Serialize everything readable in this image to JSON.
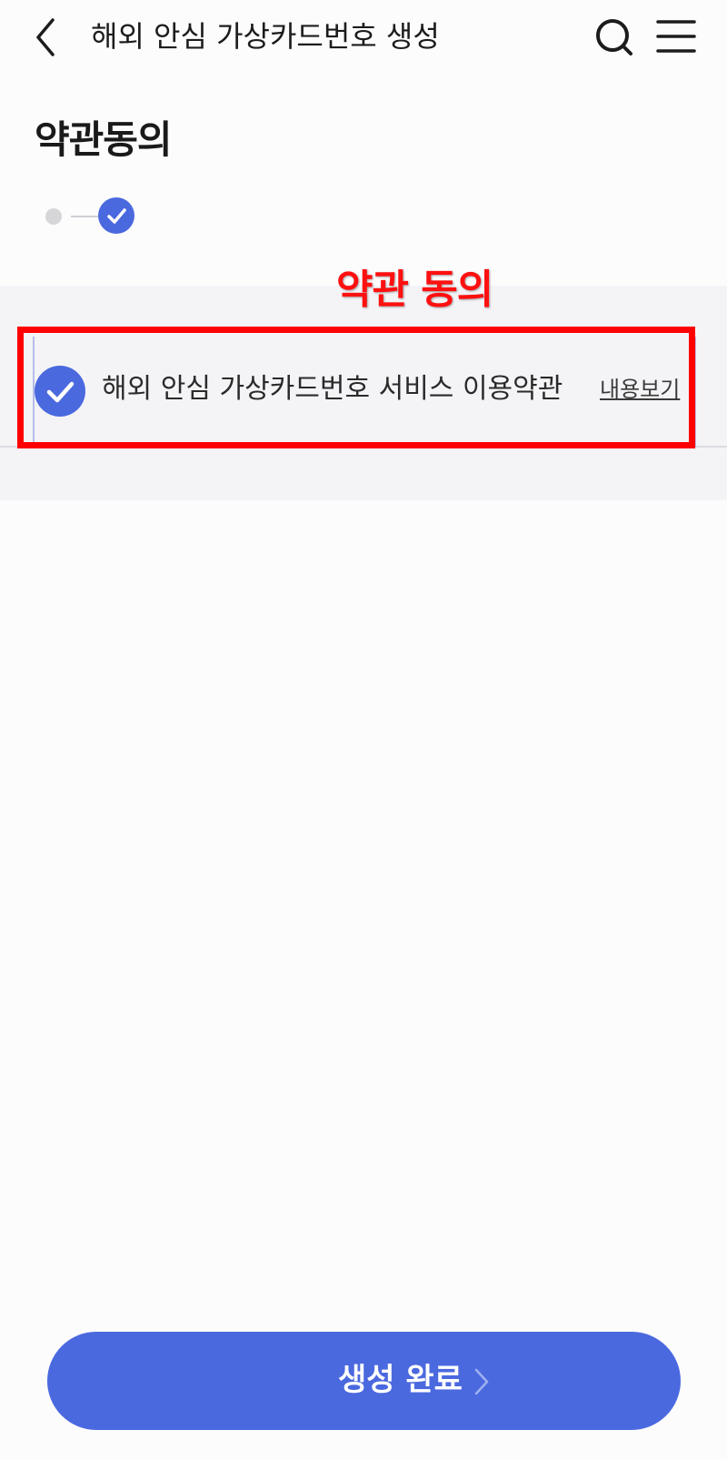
{
  "header": {
    "title": "해외 안심 가상카드번호 생성",
    "back_icon": "chevron-left-icon",
    "search_icon": "search-icon",
    "menu_icon": "hamburger-menu-icon"
  },
  "page": {
    "heading": "약관동의"
  },
  "stepper": {
    "total_steps": 2,
    "current_step": 2
  },
  "annotation": {
    "label": "약관 동의",
    "color": "#ff0000"
  },
  "agreement": {
    "label": "해외 안심 가상카드번호 서비스 이용약관",
    "checked": true,
    "view_link": "내용보기"
  },
  "footer": {
    "complete_button": "생성 완료"
  },
  "colors": {
    "accent": "#4b69de",
    "annotation": "#ff0000",
    "section_bg": "#f4f4f7"
  }
}
